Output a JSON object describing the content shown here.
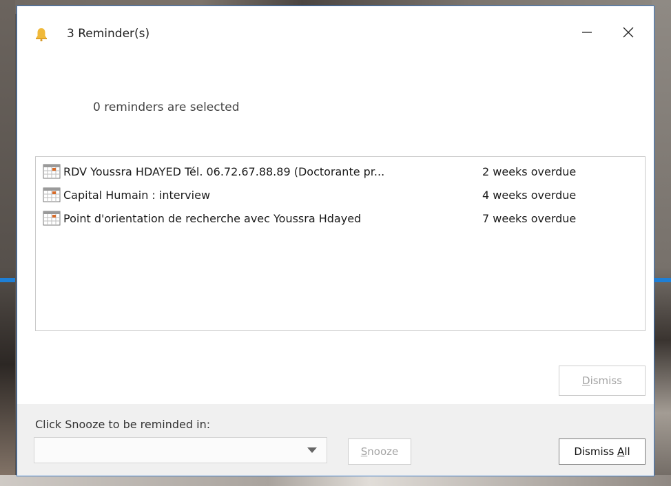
{
  "window": {
    "title": "3 Reminder(s)",
    "icon": "bell-icon",
    "minimize_glyph": "—",
    "close_glyph": "✕"
  },
  "status": {
    "selected_text": "0 reminders are selected"
  },
  "reminders": [
    {
      "subject": "RDV Youssra HDAYED Tél. 06.72.67.88.89 (Doctorante pr...",
      "due": "2 weeks overdue",
      "icon": "calendar-icon"
    },
    {
      "subject": "Capital Humain : interview",
      "due": "4 weeks overdue",
      "icon": "calendar-icon"
    },
    {
      "subject": "Point d'orientation de recherche avec Youssra Hdayed",
      "due": "7 weeks overdue",
      "icon": "calendar-icon"
    }
  ],
  "buttons": {
    "dismiss": {
      "mnemonic": "D",
      "rest": "ismiss",
      "enabled": false
    },
    "snooze": {
      "mnemonic": "S",
      "rest": "nooze",
      "enabled": false
    },
    "dismiss_all": {
      "prefix": "Dismiss ",
      "mnemonic": "A",
      "rest": "ll",
      "enabled": true
    }
  },
  "snooze": {
    "label": "Click Snooze to be reminded in:",
    "selected_value": ""
  },
  "colors": {
    "window_border": "#3a79c6",
    "bell": "#f0b93a",
    "calendar_icon": "#d86a28",
    "desktop_accent": "#1e7fd6"
  }
}
